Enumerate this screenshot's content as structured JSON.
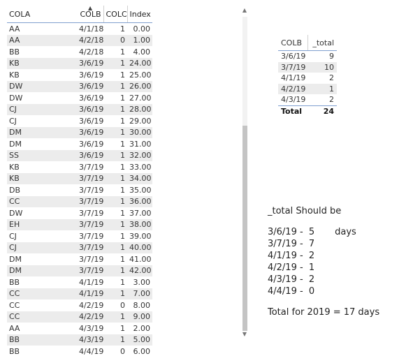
{
  "main_table": {
    "headers": [
      "COLA",
      "COLB",
      "COLC",
      "Index"
    ],
    "sort_icon": "sort-ascending-icon",
    "rows": [
      [
        "AA",
        "4/1/18",
        "1",
        "0.00"
      ],
      [
        "AA",
        "4/2/18",
        "0",
        "1.00"
      ],
      [
        "BB",
        "4/2/18",
        "1",
        "4.00"
      ],
      [
        "KB",
        "3/6/19",
        "1",
        "24.00"
      ],
      [
        "KB",
        "3/6/19",
        "1",
        "25.00"
      ],
      [
        "DW",
        "3/6/19",
        "1",
        "26.00"
      ],
      [
        "DW",
        "3/6/19",
        "1",
        "27.00"
      ],
      [
        "CJ",
        "3/6/19",
        "1",
        "28.00"
      ],
      [
        "CJ",
        "3/6/19",
        "1",
        "29.00"
      ],
      [
        "DM",
        "3/6/19",
        "1",
        "30.00"
      ],
      [
        "DM",
        "3/6/19",
        "1",
        "31.00"
      ],
      [
        "SS",
        "3/6/19",
        "1",
        "32.00"
      ],
      [
        "KB",
        "3/7/19",
        "1",
        "33.00"
      ],
      [
        "KB",
        "3/7/19",
        "1",
        "34.00"
      ],
      [
        "DB",
        "3/7/19",
        "1",
        "35.00"
      ],
      [
        "CC",
        "3/7/19",
        "1",
        "36.00"
      ],
      [
        "DW",
        "3/7/19",
        "1",
        "37.00"
      ],
      [
        "EH",
        "3/7/19",
        "1",
        "38.00"
      ],
      [
        "CJ",
        "3/7/19",
        "1",
        "39.00"
      ],
      [
        "CJ",
        "3/7/19",
        "1",
        "40.00"
      ],
      [
        "DM",
        "3/7/19",
        "1",
        "41.00"
      ],
      [
        "DM",
        "3/7/19",
        "1",
        "42.00"
      ],
      [
        "BB",
        "4/1/19",
        "1",
        "3.00"
      ],
      [
        "CC",
        "4/1/19",
        "1",
        "7.00"
      ],
      [
        "CC",
        "4/2/19",
        "0",
        "8.00"
      ],
      [
        "CC",
        "4/2/19",
        "1",
        "9.00"
      ],
      [
        "AA",
        "4/3/19",
        "1",
        "2.00"
      ],
      [
        "BB",
        "4/3/19",
        "1",
        "5.00"
      ],
      [
        "BB",
        "4/4/19",
        "0",
        "6.00"
      ]
    ]
  },
  "summary_table": {
    "headers": [
      "COLB",
      "_total"
    ],
    "rows": [
      [
        "3/6/19",
        "9"
      ],
      [
        "3/7/19",
        "10"
      ],
      [
        "4/1/19",
        "2"
      ],
      [
        "4/2/19",
        "1"
      ],
      [
        "4/3/19",
        "2"
      ]
    ],
    "total_label": "Total",
    "total_value": "24"
  },
  "note": {
    "heading": "_total Should be",
    "lines": [
      "3/6/19 -  5       days",
      "3/7/19 -  7",
      "4/1/19 -  2",
      "4/2/19 -  1",
      "4/3/19 -  2",
      "4/4/19 -  0"
    ],
    "total_line": "Total for 2019 = 17 days"
  },
  "scrollbar": {
    "up_icon": "scroll-up-arrow-icon",
    "down_icon": "scroll-down-arrow-icon",
    "position": 0.35
  }
}
